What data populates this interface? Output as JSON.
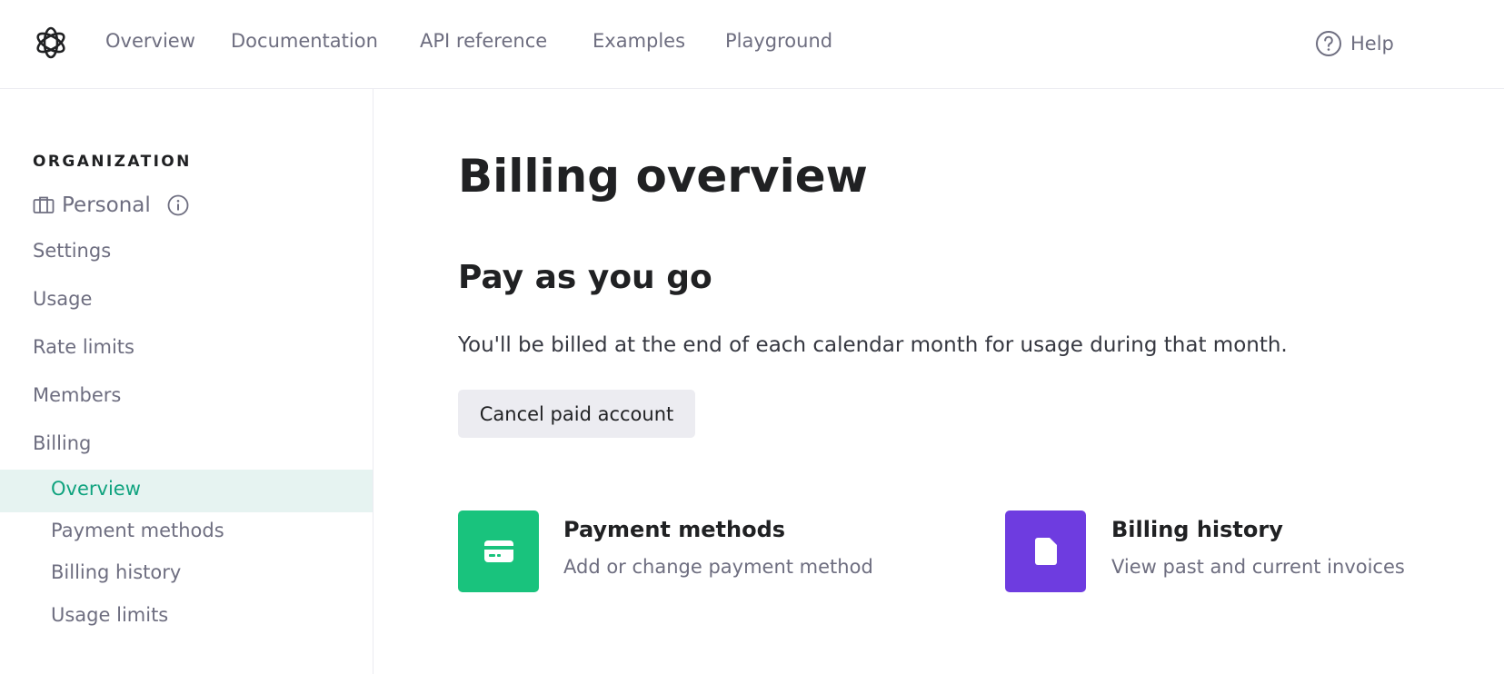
{
  "topnav": {
    "links": [
      "Overview",
      "Documentation",
      "API reference",
      "Examples",
      "Playground"
    ],
    "help_label": "Help"
  },
  "sidebar": {
    "heading": "ORGANIZATION",
    "org_name": "Personal",
    "items": [
      "Settings",
      "Usage",
      "Rate limits",
      "Members",
      "Billing"
    ],
    "billing_sub": [
      "Overview",
      "Payment methods",
      "Billing history",
      "Usage limits"
    ],
    "active_item": "Overview"
  },
  "main": {
    "title": "Billing overview",
    "section_title": "Pay as you go",
    "description": "You'll be billed at the end of each calendar month for usage during that month.",
    "cancel_button": "Cancel paid account",
    "cards": [
      {
        "title": "Payment methods",
        "subtitle": "Add or change payment method",
        "icon": "credit-card-icon",
        "color": "#19c37d"
      },
      {
        "title": "Billing history",
        "subtitle": "View past and current invoices",
        "icon": "document-icon",
        "color": "#6e3ce0"
      }
    ]
  },
  "colors": {
    "accent": "#10a37f",
    "active_bg": "#e6f3f1",
    "muted_text": "#6e6e80"
  }
}
